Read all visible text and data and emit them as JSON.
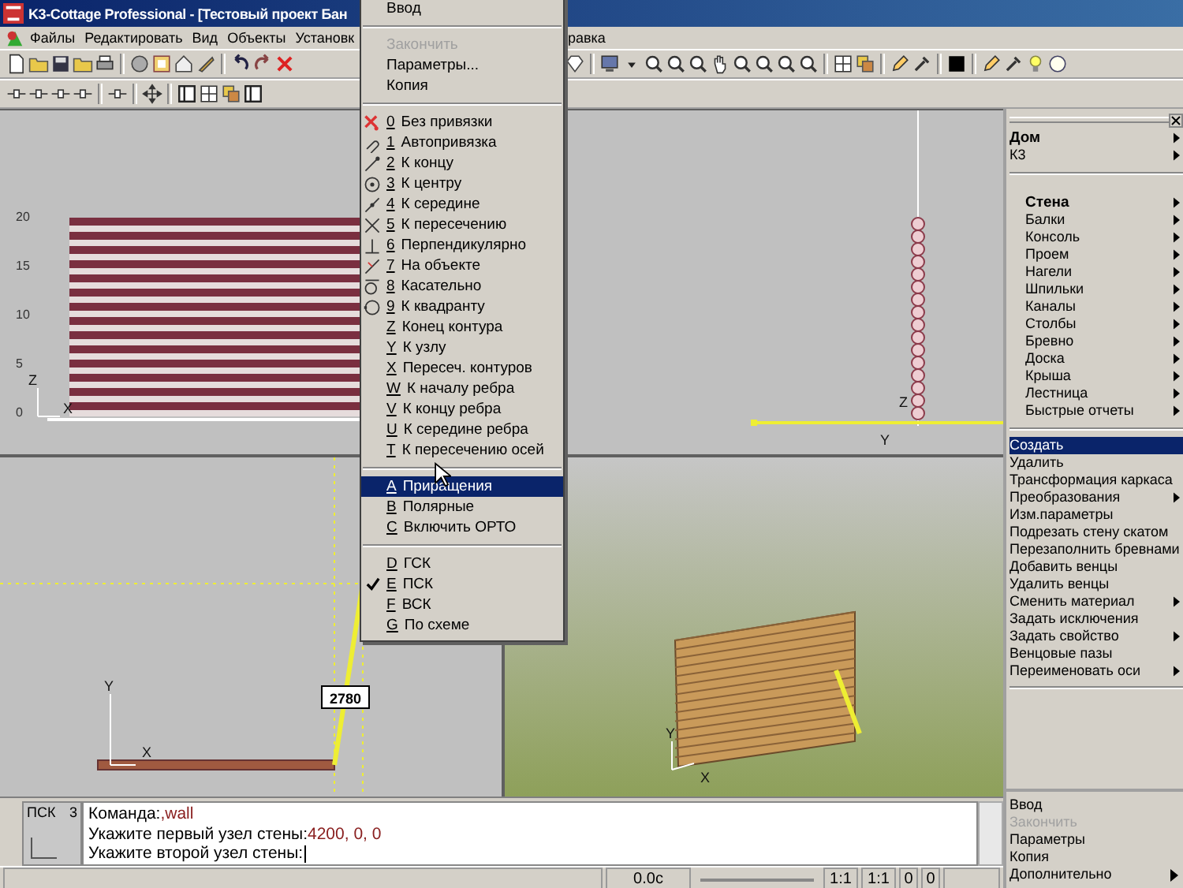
{
  "window": {
    "title": "K3-Cottage Professional - [Тестовый проект Бан"
  },
  "menubar": {
    "items": [
      "Файлы",
      "Редактировать",
      "Вид",
      "Объекты",
      "Установк"
    ],
    "items_right": [
      "равка"
    ]
  },
  "popup_menu": {
    "items": [
      {
        "kind": "command",
        "label": "Ввод",
        "disabled": false,
        "selected": false,
        "checked": false
      },
      {
        "kind": "separator"
      },
      {
        "kind": "command",
        "label": "Закончить",
        "disabled": true,
        "selected": false,
        "checked": false
      },
      {
        "kind": "command",
        "label": "Параметры...",
        "disabled": false,
        "selected": false,
        "checked": false
      },
      {
        "kind": "command",
        "label": "Копия",
        "disabled": false,
        "selected": false,
        "checked": false
      },
      {
        "kind": "separator"
      },
      {
        "kind": "snap",
        "hotkey": "0",
        "label": "Без привязки",
        "disabled": false,
        "selected": false,
        "checked": false
      },
      {
        "kind": "snap",
        "hotkey": "1",
        "label": "Автопривязка",
        "disabled": false,
        "selected": false,
        "checked": false
      },
      {
        "kind": "snap",
        "hotkey": "2",
        "label": "К концу",
        "disabled": false,
        "selected": false,
        "checked": false
      },
      {
        "kind": "snap",
        "hotkey": "3",
        "label": "К центру",
        "disabled": false,
        "selected": false,
        "checked": false
      },
      {
        "kind": "snap",
        "hotkey": "4",
        "label": "К середине",
        "disabled": false,
        "selected": false,
        "checked": false
      },
      {
        "kind": "snap",
        "hotkey": "5",
        "label": "К пересечению",
        "disabled": false,
        "selected": false,
        "checked": false
      },
      {
        "kind": "snap",
        "hotkey": "6",
        "label": "Перпендикулярно",
        "disabled": false,
        "selected": false,
        "checked": false
      },
      {
        "kind": "snap",
        "hotkey": "7",
        "label": "На объекте",
        "disabled": false,
        "selected": false,
        "checked": false
      },
      {
        "kind": "snap",
        "hotkey": "8",
        "label": "Касательно",
        "disabled": false,
        "selected": false,
        "checked": false
      },
      {
        "kind": "snap",
        "hotkey": "9",
        "label": "К квадранту",
        "disabled": false,
        "selected": false,
        "checked": false
      },
      {
        "kind": "snap",
        "hotkey": "Z",
        "label": "Конец контура",
        "disabled": false,
        "selected": false,
        "checked": false
      },
      {
        "kind": "snap",
        "hotkey": "Y",
        "label": "К узлу",
        "disabled": false,
        "selected": false,
        "checked": false
      },
      {
        "kind": "snap",
        "hotkey": "X",
        "label": "Пересеч. контуров",
        "disabled": false,
        "selected": false,
        "checked": false
      },
      {
        "kind": "snap",
        "hotkey": "W",
        "label": "К началу ребра",
        "disabled": false,
        "selected": false,
        "checked": false
      },
      {
        "kind": "snap",
        "hotkey": "V",
        "label": "К концу ребра",
        "disabled": false,
        "selected": false,
        "checked": false
      },
      {
        "kind": "snap",
        "hotkey": "U",
        "label": "К середине ребра",
        "disabled": false,
        "selected": false,
        "checked": false
      },
      {
        "kind": "snap",
        "hotkey": "T",
        "label": "К пересечению осей",
        "disabled": false,
        "selected": false,
        "checked": false
      },
      {
        "kind": "separator"
      },
      {
        "kind": "option",
        "hotkey": "A",
        "label": "Приращения",
        "disabled": false,
        "selected": true,
        "checked": false
      },
      {
        "kind": "option",
        "hotkey": "B",
        "label": "Полярные",
        "disabled": false,
        "selected": false,
        "checked": false
      },
      {
        "kind": "option",
        "hotkey": "C",
        "label": "Включить ОРТО",
        "disabled": false,
        "selected": false,
        "checked": false
      },
      {
        "kind": "separator"
      },
      {
        "kind": "option",
        "hotkey": "D",
        "label": "ГСК",
        "disabled": false,
        "selected": false,
        "checked": false
      },
      {
        "kind": "option",
        "hotkey": "E",
        "label": "ПСК",
        "disabled": false,
        "selected": false,
        "checked": true
      },
      {
        "kind": "option",
        "hotkey": "F",
        "label": "ВСК",
        "disabled": false,
        "selected": false,
        "checked": false
      },
      {
        "kind": "option",
        "hotkey": "G",
        "label": "По схеме",
        "disabled": false,
        "selected": false,
        "checked": false
      }
    ]
  },
  "viewports": [
    {
      "kind": "front",
      "ruler": [
        "20",
        "15",
        "10",
        "5",
        "0"
      ],
      "axis_labels": [
        "Z",
        "X"
      ]
    },
    {
      "kind": "side",
      "axis_labels": [
        "Z",
        "Y"
      ]
    },
    {
      "kind": "plan",
      "dimension": "2780",
      "axis_labels": [
        "Y",
        "X"
      ]
    },
    {
      "kind": "perspective",
      "axis_labels": [
        "Y",
        "X"
      ]
    }
  ],
  "right_panel": {
    "groups": [
      {
        "items": [
          {
            "label": "Дом",
            "bold": true,
            "submenu": true
          },
          {
            "label": "К3",
            "bold": false,
            "submenu": true
          }
        ]
      },
      {
        "items": [
          {
            "label": "Стена",
            "bold": true,
            "submenu": true
          },
          {
            "label": "Балки",
            "bold": false,
            "submenu": true
          },
          {
            "label": "Консоль",
            "bold": false,
            "submenu": true
          },
          {
            "label": "Проем",
            "bold": false,
            "submenu": true
          },
          {
            "label": "Нагели",
            "bold": false,
            "submenu": true
          },
          {
            "label": "Шпильки",
            "bold": false,
            "submenu": true
          },
          {
            "label": "Каналы",
            "bold": false,
            "submenu": true
          },
          {
            "label": "Столбы",
            "bold": false,
            "submenu": true
          },
          {
            "label": "Бревно",
            "bold": false,
            "submenu": true
          },
          {
            "label": "Доска",
            "bold": false,
            "submenu": true
          },
          {
            "label": "Крыша",
            "bold": false,
            "submenu": true
          },
          {
            "label": "Лестница",
            "bold": false,
            "submenu": true
          },
          {
            "label": "Быстрые отчеты",
            "bold": false,
            "submenu": true
          }
        ]
      }
    ],
    "actions": [
      {
        "label": "Создать",
        "selected": true,
        "submenu": false
      },
      {
        "label": "Удалить",
        "selected": false,
        "submenu": false
      },
      {
        "label": "Трансформация каркаса",
        "selected": false,
        "submenu": false
      },
      {
        "label": "Преобразования",
        "selected": false,
        "submenu": true
      },
      {
        "label": "Изм.параметры",
        "selected": false,
        "submenu": false
      },
      {
        "label": "Подрезать стену скатом",
        "selected": false,
        "submenu": false
      },
      {
        "label": "Перезаполнить бревнами",
        "selected": false,
        "submenu": false
      },
      {
        "label": "Добавить венцы",
        "selected": false,
        "submenu": false
      },
      {
        "label": "Удалить венцы",
        "selected": false,
        "submenu": false
      },
      {
        "label": "Сменить материал",
        "selected": false,
        "submenu": true
      },
      {
        "label": "Задать исключения",
        "selected": false,
        "submenu": false
      },
      {
        "label": "Задать свойство",
        "selected": false,
        "submenu": true
      },
      {
        "label": "Венцовые пазы",
        "selected": false,
        "submenu": false
      },
      {
        "label": "Переименовать оси",
        "selected": false,
        "submenu": true
      }
    ]
  },
  "command_panel": {
    "ucs_label": "ПСК",
    "ucs_number": "3",
    "lines": [
      {
        "prompt": "Команда:",
        "value": ",wall"
      },
      {
        "prompt": "Укажите первый узел стены:",
        "value": "4200, 0, 0"
      },
      {
        "prompt": "Укажите второй узел стены:"
      }
    ]
  },
  "status_bar": {
    "time": "0.0с",
    "scales": [
      "1:1",
      "1:1"
    ],
    "counters": [
      "0",
      "0"
    ]
  },
  "bottom_panel": {
    "items": [
      {
        "label": "Ввод",
        "disabled": false,
        "submenu": false
      },
      {
        "label": "Закончить",
        "disabled": true,
        "submenu": false
      },
      {
        "label": "Параметры",
        "disabled": false,
        "submenu": false
      },
      {
        "label": "Копия",
        "disabled": false,
        "submenu": false
      },
      {
        "label": "Дополнительно",
        "disabled": false,
        "submenu": true
      }
    ]
  }
}
